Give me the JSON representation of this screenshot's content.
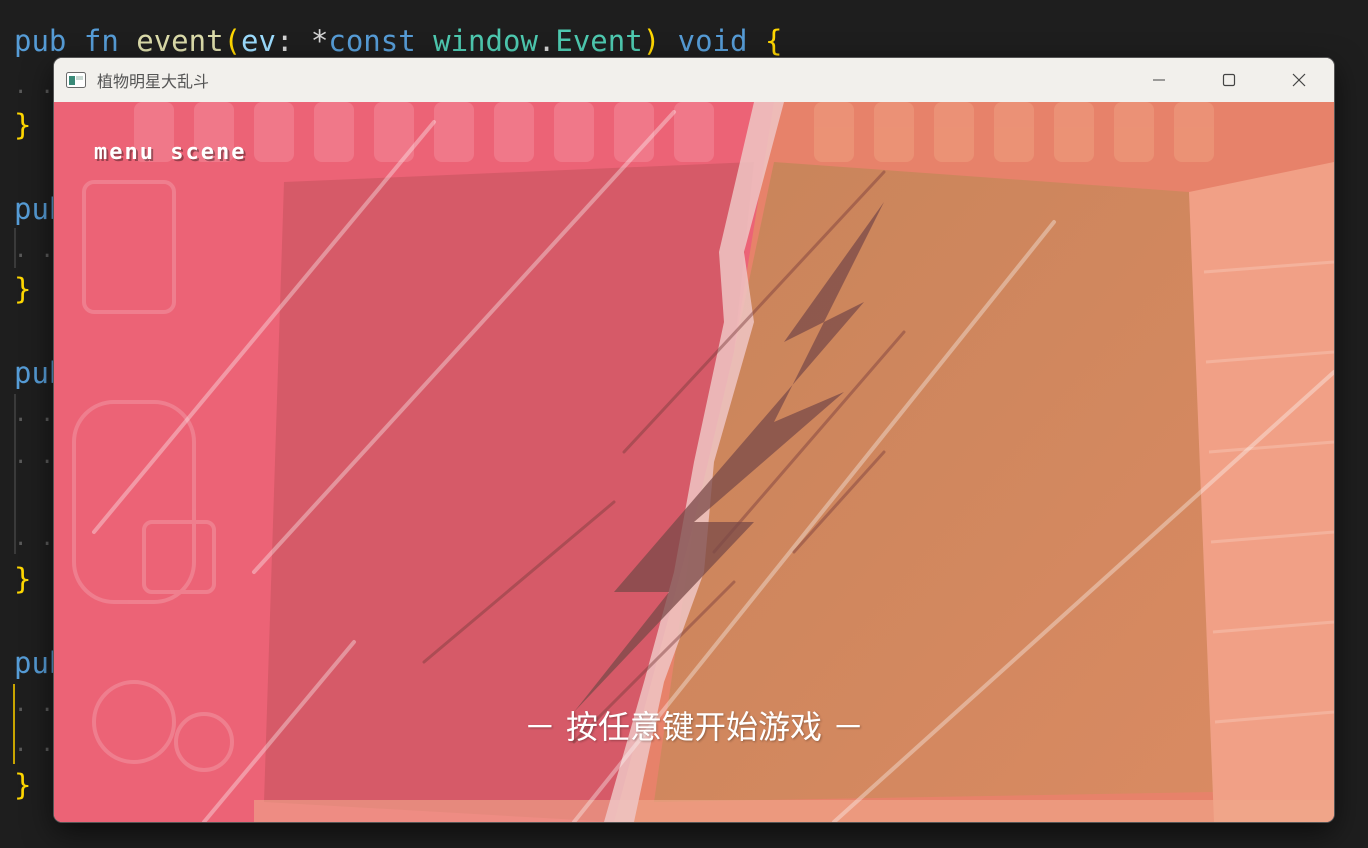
{
  "editor": {
    "line1": {
      "kw_pub": "pub",
      "kw_fn": "fn",
      "fn_name": "event",
      "paren_open": "(",
      "param": "ev",
      "colon": ":",
      "ptr": "*",
      "kw_const": "const",
      "ty_ns": "window",
      "dot": ".",
      "ty_name": "Event",
      "paren_close": ")",
      "kw_void": "void",
      "brace_open": "{"
    },
    "brace_close": "}",
    "partial_pub": "pub",
    "dots": ". ."
  },
  "window": {
    "title": "植物明星大乱斗",
    "controls": [
      "minimize",
      "maximize",
      "close"
    ],
    "menu_label": "menu scene",
    "start_prompt": "－ 按任意键开始游戏 －"
  },
  "colors": {
    "editor_bg": "#1e1e1e",
    "titlebar_bg": "#f2f0ec",
    "scene_left": "#e85f6e",
    "scene_right": "#d88a5e"
  }
}
